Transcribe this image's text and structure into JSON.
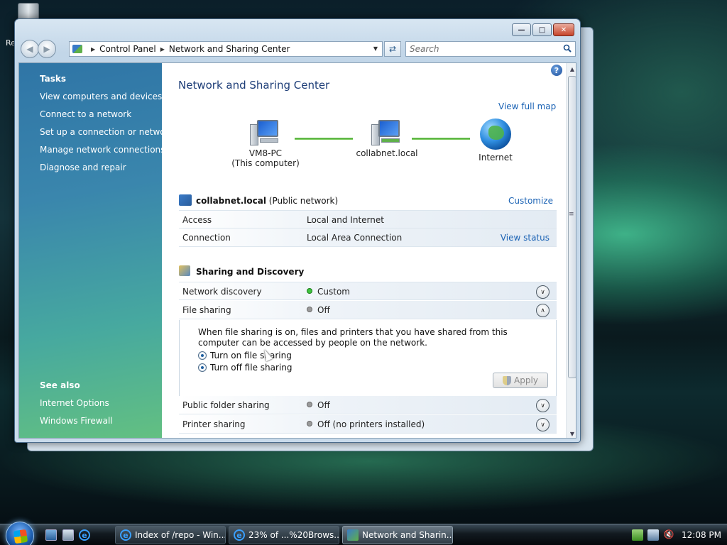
{
  "desktop": {
    "recycle_label": "Re"
  },
  "window": {
    "address": {
      "crumbs": [
        "Control Panel",
        "Network and Sharing Center"
      ]
    },
    "search": {
      "placeholder": "Search"
    },
    "tasks": {
      "title": "Tasks",
      "links": [
        "View computers and devices",
        "Connect to a network",
        "Set up a connection or network",
        "Manage network connections",
        "Diagnose and repair"
      ],
      "see_also_title": "See also",
      "see_also": [
        "Internet Options",
        "Windows Firewall"
      ]
    },
    "main": {
      "title": "Network and Sharing Center",
      "view_full_map": "View full map",
      "map": {
        "computer_name": "VM8-PC",
        "computer_sub": "(This computer)",
        "network_name": "collabnet.local",
        "internet": "Internet"
      },
      "network": {
        "name": "collabnet.local",
        "type": "(Public network)",
        "customize": "Customize",
        "access_label": "Access",
        "access_value": "Local and Internet",
        "connection_label": "Connection",
        "connection_value": "Local Area Connection",
        "view_status": "View status"
      },
      "sharing": {
        "title": "Sharing and Discovery",
        "network_discovery_label": "Network discovery",
        "network_discovery_value": "Custom",
        "file_sharing_label": "File sharing",
        "file_sharing_value": "Off",
        "file_sharing_desc": "When file sharing is on, files and printers that you have shared from this computer can be accessed by people on the network.",
        "turn_on": "Turn on file sharing",
        "turn_off": "Turn off file sharing",
        "apply": "Apply",
        "public_folder_label": "Public folder sharing",
        "public_folder_value": "Off",
        "printer_label": "Printer sharing",
        "printer_value": "Off (no printers installed)"
      }
    }
  },
  "taskbar": {
    "tasks": [
      "Index of /repo - Win...",
      "23% of ...%20Brows...",
      "Network and Sharin..."
    ],
    "clock": "12:08 PM"
  }
}
